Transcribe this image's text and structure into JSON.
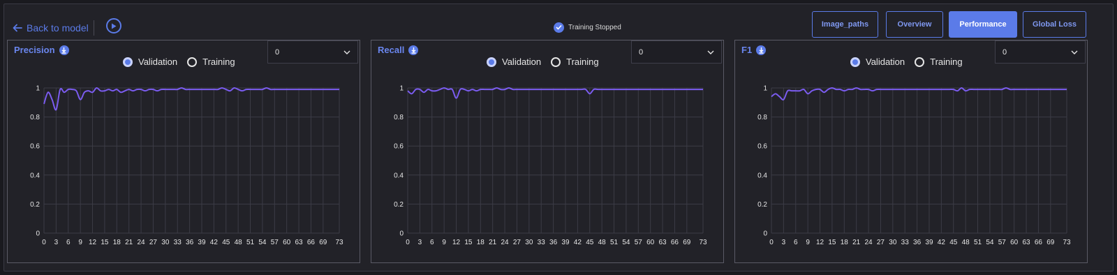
{
  "header": {
    "back_label": "Back to model",
    "status_text": "Training Stopped",
    "tabs": [
      {
        "label": "Image_paths",
        "active": false
      },
      {
        "label": "Overview",
        "active": false
      },
      {
        "label": "Performance",
        "active": true
      },
      {
        "label": "Global Loss",
        "active": false
      }
    ]
  },
  "colors": {
    "accent": "#5b7be8",
    "line": "#7b5cf0",
    "grid": "#3c3c46"
  },
  "icons": {
    "back": "arrow-left-icon",
    "play": "play-icon",
    "status": "check-circle-icon",
    "download": "download-icon",
    "dropdown": "chevron-down-icon"
  },
  "panels": [
    {
      "title": "Precision",
      "dropdown_value": "0",
      "radio_validation": "Validation",
      "radio_training": "Training",
      "selected": "Validation",
      "chart_data": {
        "type": "line",
        "x": [
          0,
          1,
          2,
          3,
          4,
          5,
          6,
          7,
          8,
          9,
          10,
          11,
          12,
          13,
          14,
          15,
          16,
          17,
          18,
          19,
          20,
          21,
          22,
          23,
          24,
          25,
          26,
          27,
          28,
          29,
          30,
          31,
          32,
          33,
          34,
          35,
          36,
          37,
          38,
          39,
          40,
          41,
          42,
          43,
          44,
          45,
          46,
          47,
          48,
          49,
          50,
          51,
          52,
          53,
          54,
          55,
          56,
          57,
          58,
          59,
          60,
          61,
          62,
          63,
          64,
          65,
          66,
          67,
          68,
          69,
          70,
          71,
          72,
          73
        ],
        "series": [
          {
            "values": [
              0.89,
              0.97,
              0.92,
              0.85,
              0.99,
              0.97,
              0.99,
              0.99,
              0.98,
              0.92,
              0.97,
              0.98,
              0.97,
              1.0,
              0.98,
              0.98,
              0.99,
              0.98,
              0.99,
              0.97,
              0.98,
              0.99,
              0.98,
              0.99,
              0.99,
              0.98,
              0.99,
              0.99,
              0.98,
              0.99,
              0.99,
              0.99,
              0.99,
              0.99,
              1.0,
              0.99,
              0.99,
              0.99,
              0.99,
              0.99,
              0.99,
              0.99,
              0.99,
              0.99,
              1.0,
              0.99,
              0.98,
              1.0,
              0.99,
              0.98,
              0.99,
              0.99,
              0.99,
              0.99,
              0.99,
              1.0,
              0.99,
              0.99,
              0.99,
              0.99,
              0.99,
              0.99,
              0.99,
              0.99,
              0.99,
              0.99,
              0.99,
              0.99,
              0.99,
              0.99,
              0.99,
              0.99,
              0.99,
              0.99
            ]
          }
        ],
        "ylim": [
          0,
          1
        ],
        "yticks": [
          "0",
          "0.2",
          "0.4",
          "0.6",
          "0.8",
          "1"
        ],
        "xticks": [
          "0",
          "3",
          "6",
          "9",
          "12",
          "15",
          "18",
          "21",
          "24",
          "27",
          "30",
          "33",
          "36",
          "39",
          "42",
          "45",
          "48",
          "51",
          "54",
          "57",
          "60",
          "63",
          "66",
          "69",
          "73"
        ],
        "grid": true
      }
    },
    {
      "title": "Recall",
      "dropdown_value": "0",
      "radio_validation": "Validation",
      "radio_training": "Training",
      "selected": "Validation",
      "chart_data": {
        "type": "line",
        "x": [
          0,
          1,
          2,
          3,
          4,
          5,
          6,
          7,
          8,
          9,
          10,
          11,
          12,
          13,
          14,
          15,
          16,
          17,
          18,
          19,
          20,
          21,
          22,
          23,
          24,
          25,
          26,
          27,
          28,
          29,
          30,
          31,
          32,
          33,
          34,
          35,
          36,
          37,
          38,
          39,
          40,
          41,
          42,
          43,
          44,
          45,
          46,
          47,
          48,
          49,
          50,
          51,
          52,
          53,
          54,
          55,
          56,
          57,
          58,
          59,
          60,
          61,
          62,
          63,
          64,
          65,
          66,
          67,
          68,
          69,
          70,
          71,
          72,
          73
        ],
        "series": [
          {
            "values": [
              0.98,
              0.96,
              0.99,
              0.99,
              0.97,
              0.99,
              0.98,
              0.98,
              0.99,
              1.0,
              0.99,
              0.99,
              0.93,
              0.99,
              0.99,
              0.98,
              0.99,
              0.98,
              0.99,
              0.99,
              0.99,
              0.99,
              1.0,
              0.99,
              0.99,
              1.0,
              0.99,
              0.99,
              0.99,
              0.99,
              0.99,
              0.99,
              0.99,
              0.99,
              0.99,
              0.99,
              0.99,
              0.99,
              0.99,
              0.99,
              0.99,
              0.99,
              0.99,
              0.99,
              0.99,
              0.96,
              0.99,
              0.99,
              0.99,
              0.99,
              0.99,
              0.99,
              0.99,
              0.99,
              0.99,
              0.99,
              0.99,
              0.99,
              0.99,
              0.99,
              0.99,
              0.99,
              0.99,
              0.99,
              0.99,
              0.99,
              0.99,
              0.99,
              0.99,
              0.99,
              0.99,
              0.99,
              0.99,
              0.99
            ]
          }
        ],
        "ylim": [
          0,
          1
        ],
        "yticks": [
          "0",
          "0.2",
          "0.4",
          "0.6",
          "0.8",
          "1"
        ],
        "xticks": [
          "0",
          "3",
          "6",
          "9",
          "12",
          "15",
          "18",
          "21",
          "24",
          "27",
          "30",
          "33",
          "36",
          "39",
          "42",
          "45",
          "48",
          "51",
          "54",
          "57",
          "60",
          "63",
          "66",
          "69",
          "73"
        ],
        "grid": true
      }
    },
    {
      "title": "F1",
      "dropdown_value": "0",
      "radio_validation": "Validation",
      "radio_training": "Training",
      "selected": "Validation",
      "chart_data": {
        "type": "line",
        "x": [
          0,
          1,
          2,
          3,
          4,
          5,
          6,
          7,
          8,
          9,
          10,
          11,
          12,
          13,
          14,
          15,
          16,
          17,
          18,
          19,
          20,
          21,
          22,
          23,
          24,
          25,
          26,
          27,
          28,
          29,
          30,
          31,
          32,
          33,
          34,
          35,
          36,
          37,
          38,
          39,
          40,
          41,
          42,
          43,
          44,
          45,
          46,
          47,
          48,
          49,
          50,
          51,
          52,
          53,
          54,
          55,
          56,
          57,
          58,
          59,
          60,
          61,
          62,
          63,
          64,
          65,
          66,
          67,
          68,
          69,
          70,
          71,
          72,
          73
        ],
        "series": [
          {
            "values": [
              0.94,
              0.96,
              0.94,
              0.92,
              0.98,
              0.98,
              0.98,
              0.98,
              0.99,
              0.96,
              0.98,
              0.99,
              0.99,
              0.97,
              0.99,
              1.0,
              0.99,
              0.99,
              0.98,
              0.99,
              0.99,
              1.0,
              0.99,
              0.99,
              0.99,
              0.98,
              0.99,
              0.99,
              0.99,
              0.99,
              0.99,
              0.99,
              0.99,
              0.99,
              0.99,
              0.99,
              0.99,
              0.99,
              0.99,
              0.99,
              0.99,
              0.99,
              0.99,
              0.99,
              0.99,
              0.99,
              0.98,
              1.0,
              0.98,
              0.99,
              0.99,
              0.99,
              0.99,
              0.99,
              0.99,
              0.99,
              0.99,
              0.99,
              1.0,
              0.99,
              0.99,
              0.99,
              0.99,
              0.99,
              0.99,
              0.99,
              0.99,
              0.99,
              0.99,
              0.99,
              0.99,
              0.99,
              0.99,
              0.99
            ]
          }
        ],
        "ylim": [
          0,
          1
        ],
        "yticks": [
          "0",
          "0.2",
          "0.4",
          "0.6",
          "0.8",
          "1"
        ],
        "xticks": [
          "0",
          "3",
          "6",
          "9",
          "12",
          "15",
          "18",
          "21",
          "24",
          "27",
          "30",
          "33",
          "36",
          "39",
          "42",
          "45",
          "48",
          "51",
          "54",
          "57",
          "60",
          "63",
          "66",
          "69",
          "73"
        ],
        "grid": true
      }
    }
  ]
}
